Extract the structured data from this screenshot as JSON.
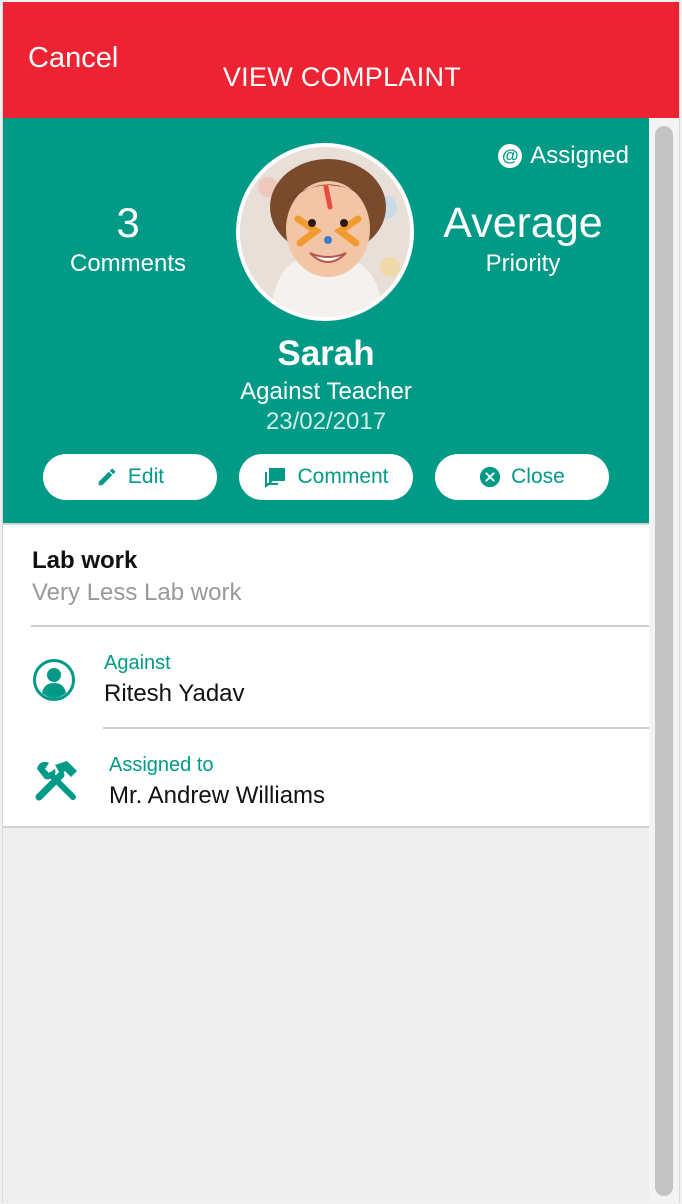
{
  "nav": {
    "cancel_label": "Cancel",
    "title": "VIEW COMPLAINT"
  },
  "complaint": {
    "status": "Assigned",
    "comments_count": "3",
    "comments_label": "Comments",
    "priority_value": "Average",
    "priority_label": "Priority",
    "name": "Sarah",
    "category": "Against Teacher",
    "date": "23/02/2017",
    "subject": "Lab work",
    "description": "Very Less Lab work"
  },
  "actions": {
    "edit": "Edit",
    "comment": "Comment",
    "close": "Close"
  },
  "details": {
    "against_label": "Against",
    "against_value": "Ritesh Yadav",
    "assigned_label": "Assigned to",
    "assigned_value": "Mr. Andrew Williams"
  },
  "colors": {
    "nav": "#ed2232",
    "accent": "#009a87"
  },
  "icons": [
    "at-icon",
    "pencil-icon",
    "comment-icon",
    "close-circle-icon",
    "person-icon",
    "tools-icon"
  ]
}
